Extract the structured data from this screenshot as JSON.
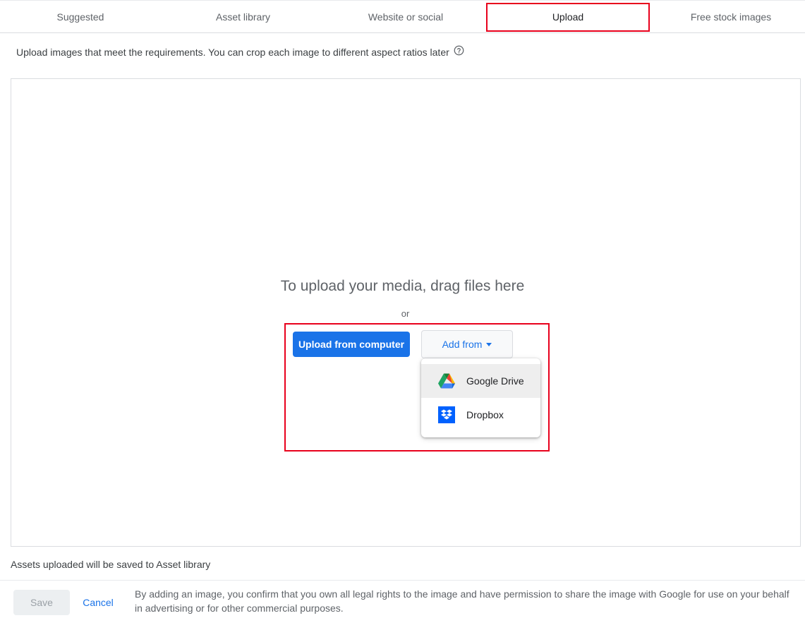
{
  "tabs": [
    {
      "label": "Suggested"
    },
    {
      "label": "Asset library"
    },
    {
      "label": "Website or social"
    },
    {
      "label": "Upload",
      "active": true
    },
    {
      "label": "Free stock images"
    }
  ],
  "description": "Upload images that meet the requirements. You can crop each image to different aspect ratios later",
  "dropzone": {
    "title": "To upload your media, drag files here",
    "or": "or",
    "upload_button": "Upload from computer",
    "add_from_button": "Add from",
    "menu": [
      {
        "label": "Google Drive",
        "icon": "google-drive-icon"
      },
      {
        "label": "Dropbox",
        "icon": "dropbox-icon"
      }
    ]
  },
  "saved_note": "Assets uploaded will be saved to Asset library",
  "footer": {
    "save_label": "Save",
    "cancel_label": "Cancel",
    "legal_text": "By adding an image, you confirm that you own all legal rights to the image and have permission to share the image with Google for use on your behalf in advertising or for other commercial purposes."
  },
  "colors": {
    "accent": "#1a73e8",
    "highlight": "#e8001c"
  }
}
